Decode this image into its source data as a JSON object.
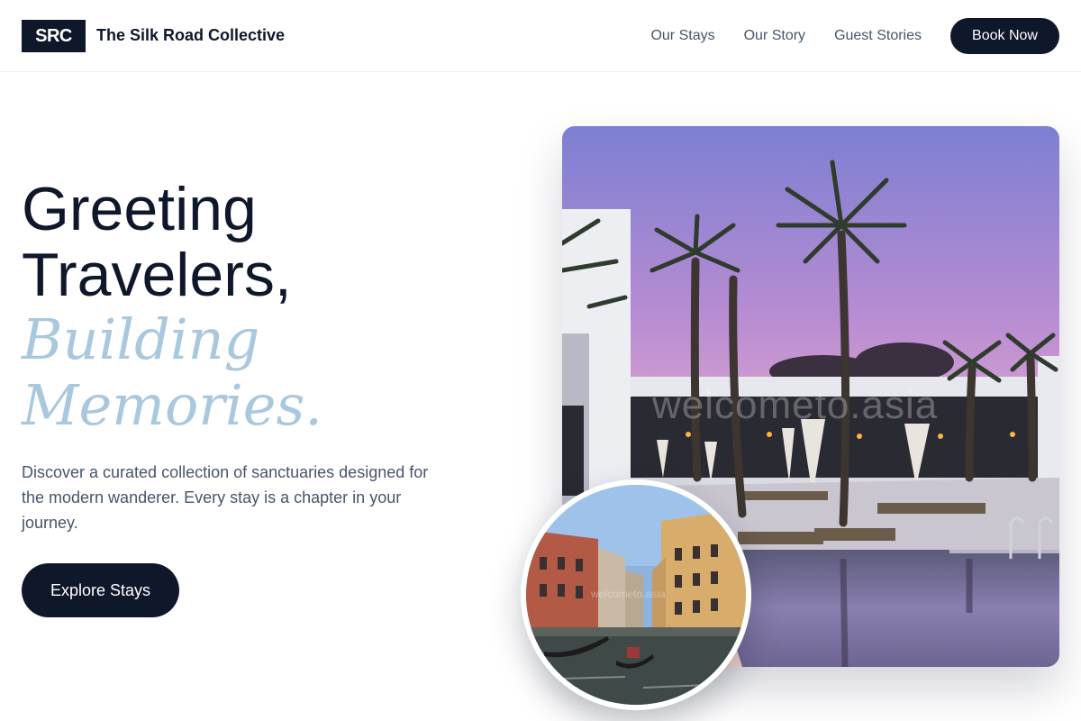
{
  "brand": {
    "logo_text": "SRC",
    "name": "The Silk Road Collective"
  },
  "nav": {
    "links": [
      "Our Stays",
      "Our Story",
      "Guest Stories"
    ],
    "cta_label": "Book Now"
  },
  "hero": {
    "title_line1": "Greeting",
    "title_line2": "Travelers,",
    "accent_line1": "Building",
    "accent_line2": "Memories.",
    "description": "Discover a curated collection of sanctuaries designed for the modern wanderer. Every stay is a chapter in your journey.",
    "cta_label": "Explore Stays"
  },
  "images": {
    "main": {
      "icon": "resort-pool-photo",
      "watermark": "welcometo.asia"
    },
    "inset": {
      "icon": "venice-canal-photo",
      "watermark": "welcometo.asia"
    }
  },
  "colors": {
    "primary": "#0f172a",
    "accent": "#a9c8de",
    "muted": "#475569"
  }
}
